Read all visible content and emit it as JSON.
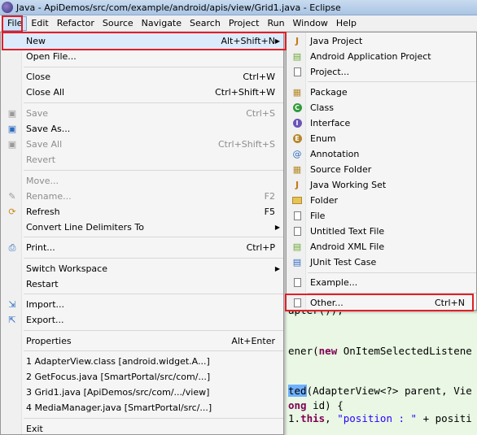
{
  "window": {
    "title": "Java - ApiDemos/src/com/example/android/apis/view/Grid1.java - Eclipse"
  },
  "menubar": [
    "File",
    "Edit",
    "Refactor",
    "Source",
    "Navigate",
    "Search",
    "Project",
    "Run",
    "Window",
    "Help"
  ],
  "file_menu": {
    "new": {
      "label": "New",
      "shortcut": "Alt+Shift+N"
    },
    "open_file": {
      "label": "Open File..."
    },
    "close": {
      "label": "Close",
      "shortcut": "Ctrl+W"
    },
    "close_all": {
      "label": "Close All",
      "shortcut": "Ctrl+Shift+W"
    },
    "save": {
      "label": "Save",
      "shortcut": "Ctrl+S"
    },
    "save_as": {
      "label": "Save As..."
    },
    "save_all": {
      "label": "Save All",
      "shortcut": "Ctrl+Shift+S"
    },
    "revert": {
      "label": "Revert"
    },
    "move": {
      "label": "Move..."
    },
    "rename": {
      "label": "Rename...",
      "shortcut": "F2"
    },
    "refresh": {
      "label": "Refresh",
      "shortcut": "F5"
    },
    "convert": {
      "label": "Convert Line Delimiters To"
    },
    "print": {
      "label": "Print...",
      "shortcut": "Ctrl+P"
    },
    "switch_workspace": {
      "label": "Switch Workspace"
    },
    "restart": {
      "label": "Restart"
    },
    "import": {
      "label": "Import..."
    },
    "export": {
      "label": "Export..."
    },
    "properties": {
      "label": "Properties",
      "shortcut": "Alt+Enter"
    },
    "recent": [
      "1 AdapterView.class  [android.widget.A...]",
      "2 GetFocus.java  [SmartPortal/src/com/...]",
      "3 Grid1.java  [ApiDemos/src/com/.../view]",
      "4 MediaManager.java  [SmartPortal/src/...]"
    ],
    "exit": {
      "label": "Exit"
    }
  },
  "new_menu": {
    "java_project": "Java Project",
    "android_app_project": "Android Application Project",
    "project": "Project...",
    "package": "Package",
    "class": "Class",
    "interface": "Interface",
    "enum": "Enum",
    "annotation": "Annotation",
    "source_folder": "Source Folder",
    "java_working_set": "Java Working Set",
    "folder": "Folder",
    "file": "File",
    "untitled_text_file": "Untitled Text File",
    "android_xml_file": "Android XML File",
    "junit_test_case": "JUnit Test Case",
    "example": "Example...",
    "other": {
      "label": "Other...",
      "shortcut": "Ctrl+N"
    }
  },
  "editor": {
    "line1": "apter());",
    "line2a": "ener(",
    "line2b": "new",
    "line2c": " OnItemSelectedListene",
    "line3a": "ted",
    "line3b": "(AdapterView<?> parent, Vie",
    "line4a": "ong",
    "line4b": " id) {",
    "line5a": "1.",
    "line5b": "this",
    "line5c": ", ",
    "line5d": "\"position : \"",
    "line5e": " + positi"
  },
  "colors": {
    "highlight_box": "#e01f26",
    "menu_selected": "#dcebfc",
    "editor_bg": "#e9f7e4"
  }
}
